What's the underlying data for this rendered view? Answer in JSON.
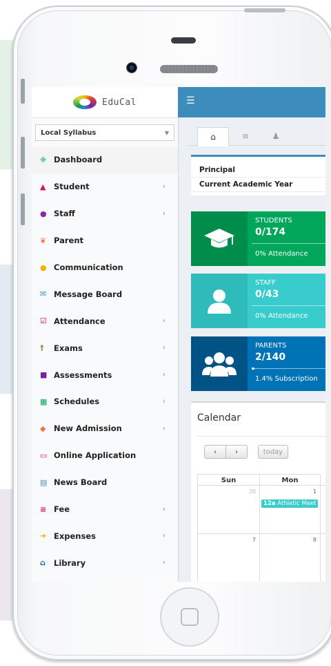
{
  "app": {
    "name": "EduCal"
  },
  "syllabus_select": {
    "value": "Local Syllabus"
  },
  "menu": [
    {
      "label": "Dashboard",
      "icon": "dashboard-icon",
      "glyph": "❈",
      "color": "#00a65a",
      "arrow": false,
      "active": true
    },
    {
      "label": "Student",
      "icon": "graduation-cap-icon",
      "glyph": "▲",
      "color": "#dd1144",
      "arrow": true
    },
    {
      "label": "Staff",
      "icon": "user-icon",
      "glyph": "●",
      "color": "#8e24aa",
      "arrow": true
    },
    {
      "label": "Parent",
      "icon": "users-icon",
      "glyph": "❦",
      "color": "#ff7043",
      "arrow": false
    },
    {
      "label": "Communication",
      "icon": "comments-icon",
      "glyph": "●",
      "color": "#f4b400",
      "arrow": false
    },
    {
      "label": "Message Board",
      "icon": "envelope-icon",
      "glyph": "✉",
      "color": "#3c8dbc",
      "arrow": false
    },
    {
      "label": "Attendance",
      "icon": "check-square-icon",
      "glyph": "☑",
      "color": "#dd1144",
      "arrow": true
    },
    {
      "label": "Exams",
      "icon": "thumbtack-icon",
      "glyph": "†",
      "color": "#a0843c",
      "arrow": true
    },
    {
      "label": "Assessments",
      "icon": "copy-icon",
      "glyph": "■",
      "color": "#7b1fa2",
      "arrow": true
    },
    {
      "label": "Schedules",
      "icon": "calendar-icon",
      "glyph": "▦",
      "color": "#00a65a",
      "arrow": true
    },
    {
      "label": "New Admission",
      "icon": "tag-icon",
      "glyph": "◆",
      "color": "#ff7043",
      "arrow": true
    },
    {
      "label": "Online Application",
      "icon": "laptop-icon",
      "glyph": "▭",
      "color": "#dd1144",
      "arrow": false
    },
    {
      "label": "News Board",
      "icon": "newspaper-icon",
      "glyph": "▤",
      "color": "#3c8dbc",
      "arrow": false
    },
    {
      "label": "Fee",
      "icon": "bars-icon",
      "glyph": "≡",
      "color": "#dd1144",
      "arrow": true
    },
    {
      "label": "Expenses",
      "icon": "sign-out-icon",
      "glyph": "➜",
      "color": "#f4b400",
      "arrow": true
    },
    {
      "label": "Library",
      "icon": "university-icon",
      "glyph": "⌂",
      "color": "#1e5aa8",
      "arrow": true
    }
  ],
  "arrow_glyph": "‹",
  "tabs": [
    {
      "icon": "home-icon",
      "glyph": "⌂"
    },
    {
      "icon": "list-icon",
      "glyph": "≡"
    },
    {
      "icon": "user-plus-icon",
      "glyph": "♟"
    }
  ],
  "info": {
    "principal_label": "Principal",
    "year_label": "Current Academic Year"
  },
  "stats": [
    {
      "label": "STUDENTS",
      "value": "0/174",
      "sub": "0% Attendance",
      "progress": 0.0,
      "color_box": "#008d4c",
      "color_txt": "#00a65a",
      "icon": "graduation-cap-icon"
    },
    {
      "label": "STAFF",
      "value": "0/43",
      "sub": "0% Attendance",
      "progress": 0.0,
      "color_box": "#30bbbb",
      "color_txt": "#39cccc",
      "icon": "user-icon"
    },
    {
      "label": "PARENTS",
      "value": "2/140",
      "sub": "1.4% Subscription",
      "progress": 0.014,
      "color_box": "#005384",
      "color_txt": "#0073b7",
      "icon": "users-icon"
    }
  ],
  "calendar": {
    "title": "Calendar",
    "prev_glyph": "‹",
    "next_glyph": "›",
    "today_label": "today",
    "headers": [
      "Sun",
      "Mon"
    ],
    "weeks": [
      {
        "days": [
          "30",
          "1"
        ],
        "dim": [
          true,
          false
        ]
      },
      {
        "days": [
          "7",
          "8"
        ],
        "dim": [
          false,
          false
        ]
      }
    ],
    "event": {
      "time": "12a",
      "title": "Athletic Meet"
    }
  }
}
